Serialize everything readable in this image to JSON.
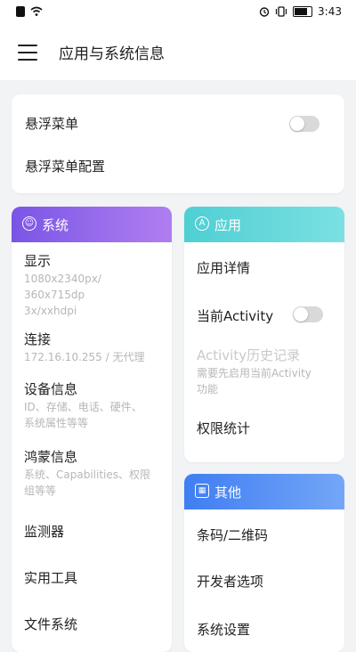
{
  "status_bar": {
    "time": "3:43",
    "icons": [
      "alert-icon",
      "wifi-icon",
      "alarm-icon",
      "vibrate-icon",
      "battery-icon"
    ]
  },
  "header": {
    "title": "应用与系统信息",
    "menu_icon": "hamburger-icon"
  },
  "floating": {
    "menu_label": "悬浮菜单",
    "menu_toggle_on": false,
    "config_label": "悬浮菜单配置"
  },
  "system_card": {
    "title": "系统",
    "color": "#8a63e8",
    "items": [
      {
        "label": "显示",
        "sub": "1080x2340px/\n360x715dp\n3x/xxhdpi"
      },
      {
        "label": "连接",
        "sub": "172.16.10.255 / 无代理"
      },
      {
        "label": "设备信息",
        "sub": "ID、存储、电话、硬件、\n系统属性等等"
      },
      {
        "label": "鸿蒙信息",
        "sub": "系统、Capabilities、权限\n组等等"
      },
      {
        "label": "监测器",
        "sub": ""
      },
      {
        "label": "实用工具",
        "sub": ""
      },
      {
        "label": "文件系统",
        "sub": ""
      }
    ]
  },
  "app_card": {
    "title": "应用",
    "color": "#5fd3d6",
    "items": [
      {
        "label": "应用详情"
      },
      {
        "label": "当前Activity",
        "toggle_on": false
      },
      {
        "label": "Activity历史记录",
        "sub": "需要先启用当前Activity\n功能",
        "disabled": true
      },
      {
        "label": "权限统计"
      }
    ]
  },
  "other_card": {
    "title": "其他",
    "color": "#4f8cf5",
    "items": [
      {
        "label": "条码/二维码"
      },
      {
        "label": "开发者选项"
      },
      {
        "label": "系统设置"
      }
    ]
  }
}
